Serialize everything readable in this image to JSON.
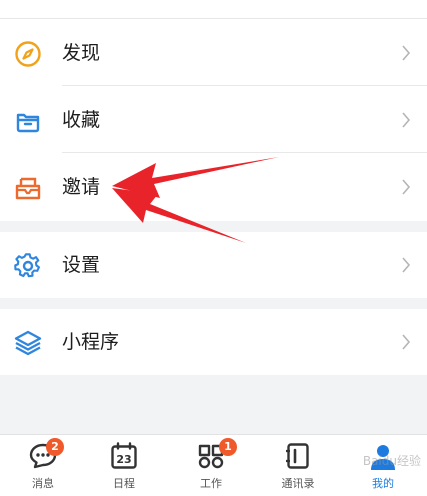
{
  "menu": {
    "items": [
      {
        "label": "发现",
        "icon": "compass-icon",
        "color": "#f0a21b"
      },
      {
        "label": "收藏",
        "icon": "folder-icon",
        "color": "#2e86de"
      },
      {
        "label": "邀请",
        "icon": "inbox-icon",
        "color": "#ec6a2e"
      },
      {
        "label": "设置",
        "icon": "gear-icon",
        "color": "#2e86de"
      },
      {
        "label": "小程序",
        "icon": "layers-icon",
        "color": "#2e86de"
      }
    ]
  },
  "tabbar": {
    "tabs": [
      {
        "label": "消息",
        "icon": "chat-bubble-icon",
        "badge": "2"
      },
      {
        "label": "日程",
        "icon": "calendar-icon",
        "day": "23"
      },
      {
        "label": "工作",
        "icon": "grid-icon",
        "badge": "1"
      },
      {
        "label": "通讯录",
        "icon": "contacts-book-icon"
      },
      {
        "label": "我的",
        "icon": "profile-icon",
        "active": true
      }
    ]
  },
  "watermark": "Baidu经验",
  "colors": {
    "accent": "#1d7be0",
    "badge": "#f0592a",
    "arrow": "#e8242a"
  }
}
